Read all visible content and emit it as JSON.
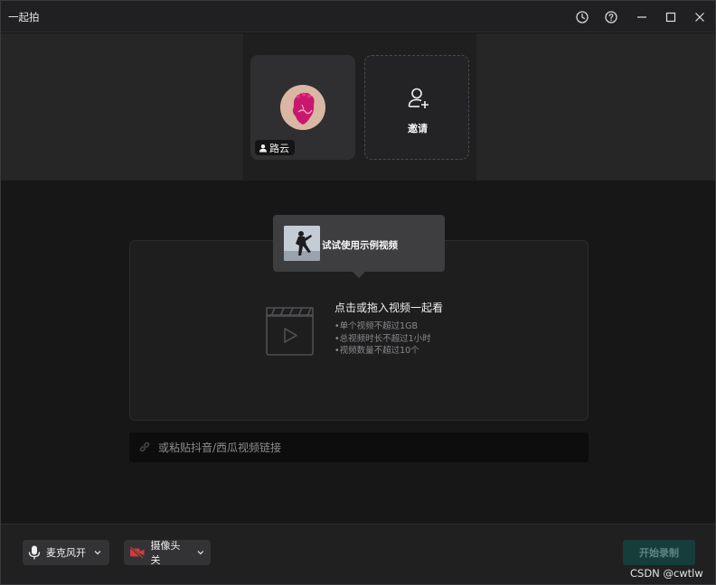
{
  "window": {
    "title": "一起拍"
  },
  "participants": {
    "user_name": "路云",
    "invite_label": "邀请"
  },
  "sample": {
    "label": "试试使用示例视频"
  },
  "drop_zone": {
    "title": "点击或拖入视频一起看",
    "notes": [
      "•单个视频不超过1GB",
      "•总视频时长不超过1小时",
      "•视频数量不超过10个"
    ]
  },
  "link_input": {
    "placeholder": "或粘贴抖音/西瓜视频链接",
    "value": ""
  },
  "controls": {
    "mic_label": "麦克风开",
    "camera_label": "摄像头关",
    "start_label": "开始录制"
  },
  "watermark": "CSDN @cwtlw",
  "colors": {
    "accent_disabled": "#173d3b",
    "camera_off_red": "#d23b3b",
    "avatar_pink": "#c8186e"
  },
  "icons": [
    "history-icon",
    "help-icon",
    "minimize-icon",
    "maximize-icon",
    "close-icon",
    "user-icon",
    "invite-user-icon",
    "clapperboard-icon",
    "link-icon",
    "microphone-icon",
    "camera-off-icon",
    "chevron-down-icon"
  ]
}
